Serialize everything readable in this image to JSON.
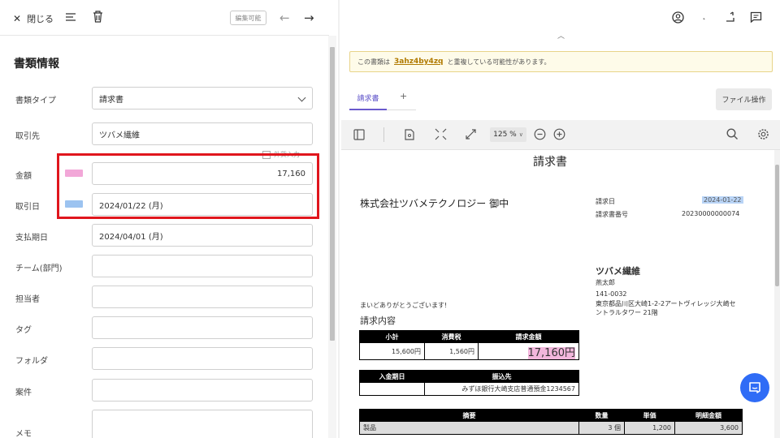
{
  "toolbar_left": {
    "close_label": "閉じる",
    "edit_badge": "編集可能",
    "prev_arrow": "←",
    "next_arrow": "→"
  },
  "form": {
    "title": "書類情報",
    "fields": {
      "doc_type": {
        "label": "書類タイプ",
        "value": "請求書"
      },
      "partner": {
        "label": "取引先",
        "value": "ツバメ繊維"
      },
      "foreign_currency": {
        "label": "外貨入力"
      },
      "amount": {
        "label": "金額",
        "value": "17,160"
      },
      "trade_date": {
        "label": "取引日",
        "value": "2024/01/22 (月)"
      },
      "due_date": {
        "label": "支払期日",
        "value": "2024/04/01 (月)"
      },
      "team": {
        "label": "チーム(部門)",
        "value": ""
      },
      "owner": {
        "label": "担当者",
        "value": ""
      },
      "tag": {
        "label": "タグ",
        "value": ""
      },
      "folder": {
        "label": "フォルダ",
        "value": ""
      },
      "project": {
        "label": "案件",
        "value": ""
      },
      "memo": {
        "label": "メモ",
        "value": ""
      }
    },
    "swatch_colors": {
      "amount": "#f2a7d8",
      "trade_date": "#9cc3f0"
    }
  },
  "notice": {
    "prefix": "この書類は",
    "link": "3ahz4by4zq",
    "suffix": "と重複している可能性があります。"
  },
  "tabs": {
    "active": "請求書",
    "add": "+"
  },
  "file_op_label": "ファイル操作",
  "viewer": {
    "zoom": "125 %"
  },
  "invoice": {
    "title": "請求書",
    "recipient": "株式会社ツバメテクノロジー 御中",
    "date_label": "請求日",
    "date_value": "2024-01-22",
    "number_label": "請求書番号",
    "number_value": "20230000000074",
    "issuer_name": "ツバメ繊維",
    "issuer_person": "燕太郎",
    "issuer_zip": "141-0032",
    "issuer_addr1": "東京都品川区大崎1-2-2アートヴィレッジ大崎セ",
    "issuer_addr2": "ントラルタワー 21階",
    "greeting": "まいどありがとうございます!",
    "content_heading": "請求内容",
    "summary_headers": [
      "小計",
      "消費税",
      "請求金額"
    ],
    "summary_values": [
      "15,600円",
      "1,560円",
      "17,160円"
    ],
    "pay_headers": [
      "入金期日",
      "振込先"
    ],
    "pay_values": [
      "",
      "みずほ銀行大崎支店普通預金1234567"
    ],
    "item_headers": [
      "摘要",
      "数量",
      "単価",
      "明細金額"
    ],
    "item_row": [
      "製品",
      "3 個",
      "1,200",
      "3,600"
    ]
  }
}
